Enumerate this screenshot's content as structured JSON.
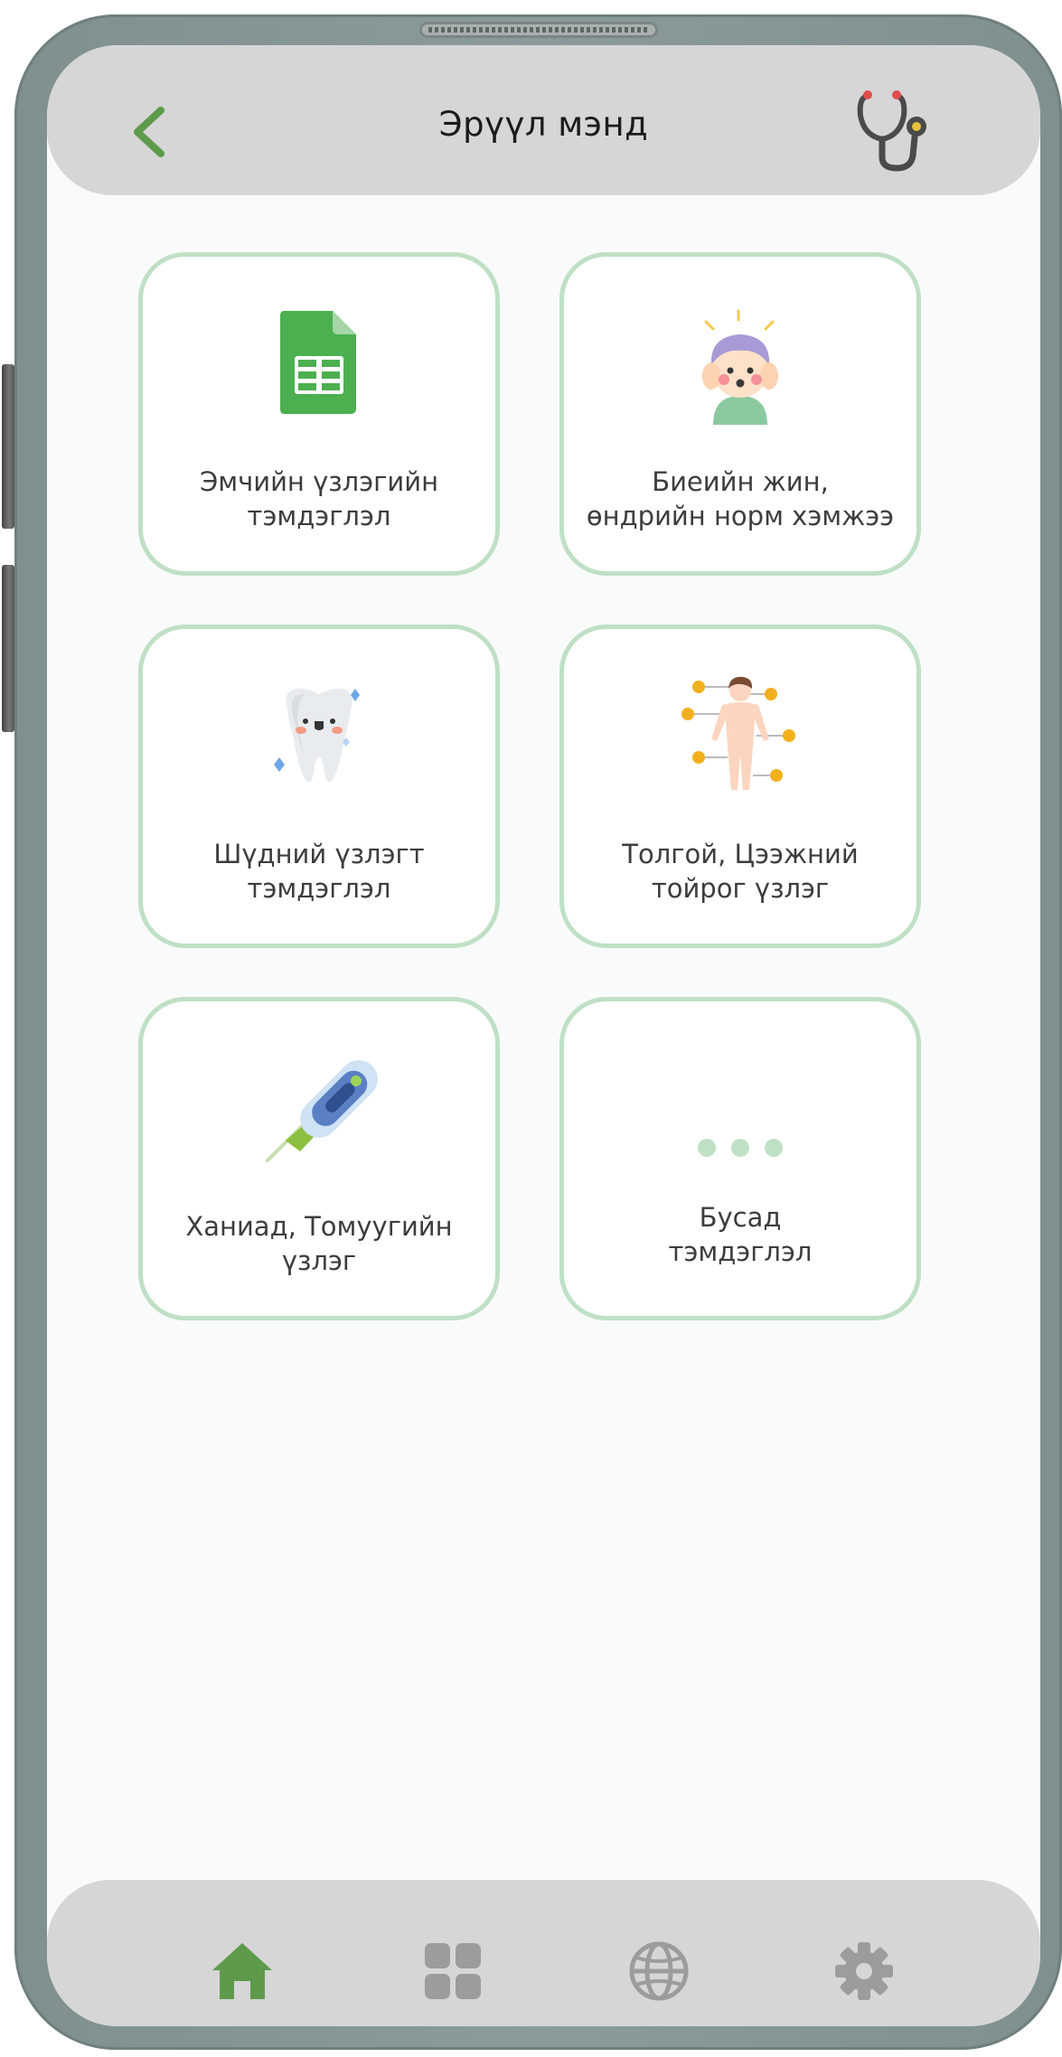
{
  "header": {
    "title": "Эрүүл мэнд",
    "back_icon": "chevron-left-icon",
    "right_icon": "stethoscope-icon"
  },
  "tiles": [
    {
      "line1": "Эмчийн үзлэгийн",
      "line2": "тэмдэглэл",
      "icon": "spreadsheet-document-icon"
    },
    {
      "line1": "Биеийн жин,",
      "line2": "өндрийн норм хэмжээ",
      "icon": "child-avatar-icon"
    },
    {
      "line1": "Шүдний үзлэгт",
      "line2": "тэмдэглэл",
      "icon": "tooth-icon"
    },
    {
      "line1": "Толгой, Цээжний",
      "line2": "тойрог үзлэг",
      "icon": "body-measurement-icon"
    },
    {
      "line1": "Ханиад, Томуугийн",
      "line2": "үзлэг",
      "icon": "thermometer-icon"
    },
    {
      "line1": "Бусад",
      "line2": "тэмдэглэл",
      "icon": "more-dots-icon"
    }
  ],
  "bottom_nav": [
    {
      "name": "home",
      "icon": "home-icon",
      "active": true
    },
    {
      "name": "apps",
      "icon": "grid-icon",
      "active": false
    },
    {
      "name": "explore",
      "icon": "globe-icon",
      "active": false
    },
    {
      "name": "settings",
      "icon": "gear-icon",
      "active": false
    }
  ],
  "colors": {
    "accent": "#5e9a4c",
    "tile_border": "#bfe0c4",
    "header_bg": "#d6d6d6",
    "screen_bg": "#f9fbfa",
    "nav_inactive": "#9c9c9c"
  }
}
